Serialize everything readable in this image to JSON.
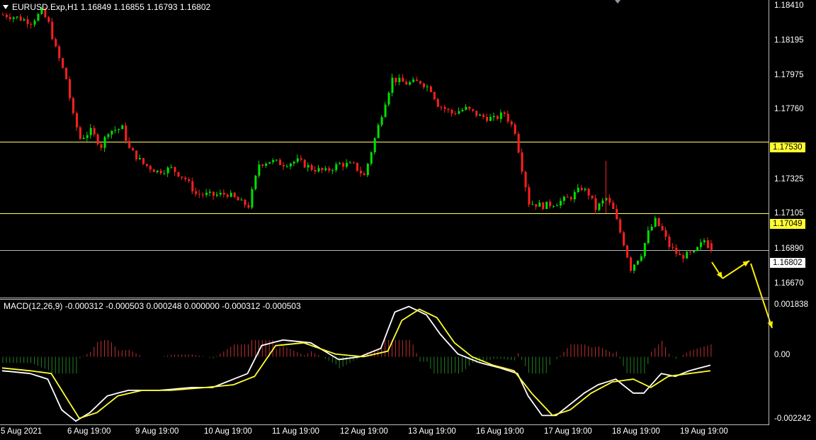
{
  "header": {
    "symbol_line": "EURUSD.Exp,H1  1.16849 1.16855 1.16793 1.16802"
  },
  "macd_header": {
    "label": "MACD(12,26,9) -0.000312 -0.000503 0.000248 0.000000 -0.000312 -0.000503"
  },
  "colors": {
    "background": "#000000",
    "bull_candle": "#00e000",
    "bear_candle": "#ff2020",
    "level_line": "#ffff66",
    "bid_line": "#b0b8c0",
    "macd_main": "#ffffff",
    "macd_signal": "#ffff33",
    "hist_positive": "#c03030",
    "hist_negative": "#208020",
    "arrows": "#ffee00"
  },
  "price_axis": {
    "labels": [
      "1.18410",
      "1.18195",
      "1.17975",
      "1.17760",
      "1.17325",
      "1.17105",
      "1.16890",
      "1.16670"
    ]
  },
  "macd_axis": {
    "labels": [
      "0.001838",
      "0.00",
      "-0.002242"
    ]
  },
  "levels": [
    {
      "price": "1.17530",
      "style": "highlight"
    },
    {
      "price": "1.17049",
      "style": "highlight"
    },
    {
      "price": "1.16802",
      "style": "bid"
    }
  ],
  "time_axis": {
    "labels": [
      "5 Aug 2021",
      "6 Aug 19:00",
      "9 Aug 19:00",
      "10 Aug 19:00",
      "11 Aug 19:00",
      "12 Aug 19:00",
      "13 Aug 19:00",
      "16 Aug 19:00",
      "17 Aug 19:00",
      "18 Aug 19:00",
      "19 Aug 19:00"
    ]
  },
  "chart_data": {
    "type": "candlestick",
    "instrument": "EURUSD.Exp",
    "timeframe": "H1",
    "ohlc_last": {
      "open": 1.16849,
      "high": 1.16855,
      "low": 1.16793,
      "close": 1.16802
    },
    "ylim": [
      1.1658,
      1.1844
    ],
    "price_path": [
      [
        0,
        1.1838
      ],
      [
        4,
        1.1836
      ],
      [
        8,
        1.1833
      ],
      [
        11,
        1.184
      ],
      [
        13,
        1.1832
      ],
      [
        15,
        1.1815
      ],
      [
        18,
        1.1795
      ],
      [
        20,
        1.177
      ],
      [
        22,
        1.1755
      ],
      [
        25,
        1.176
      ],
      [
        28,
        1.175
      ],
      [
        30,
        1.176
      ],
      [
        34,
        1.1762
      ],
      [
        36,
        1.1748
      ],
      [
        40,
        1.1738
      ],
      [
        44,
        1.1733
      ],
      [
        48,
        1.1735
      ],
      [
        52,
        1.1728
      ],
      [
        55,
        1.1718
      ],
      [
        60,
        1.1717
      ],
      [
        64,
        1.1718
      ],
      [
        68,
        1.1712
      ],
      [
        70,
        1.171
      ],
      [
        73,
        1.1738
      ],
      [
        76,
        1.174
      ],
      [
        80,
        1.1738
      ],
      [
        84,
        1.174
      ],
      [
        88,
        1.1735
      ],
      [
        92,
        1.1733
      ],
      [
        96,
        1.1738
      ],
      [
        100,
        1.1737
      ],
      [
        103,
        1.173
      ],
      [
        106,
        1.1755
      ],
      [
        109,
        1.178
      ],
      [
        111,
        1.1795
      ],
      [
        115,
        1.1792
      ],
      [
        119,
        1.1793
      ],
      [
        122,
        1.1788
      ],
      [
        124,
        1.1778
      ],
      [
        128,
        1.1772
      ],
      [
        132,
        1.1775
      ],
      [
        136,
        1.177
      ],
      [
        140,
        1.1768
      ],
      [
        143,
        1.1772
      ],
      [
        146,
        1.176
      ],
      [
        148,
        1.1735
      ],
      [
        150,
        1.1712
      ],
      [
        154,
        1.171
      ],
      [
        158,
        1.1712
      ],
      [
        162,
        1.1716
      ],
      [
        165,
        1.1722
      ],
      [
        167,
        1.1718
      ],
      [
        169,
        1.1708
      ],
      [
        172,
        1.1715
      ],
      [
        174,
        1.1707
      ],
      [
        177,
        1.1685
      ],
      [
        179,
        1.1668
      ],
      [
        182,
        1.1678
      ],
      [
        184,
        1.1692
      ],
      [
        186,
        1.17
      ],
      [
        188,
        1.1693
      ],
      [
        190,
        1.1683
      ],
      [
        193,
        1.1676
      ],
      [
        197,
        1.1678
      ],
      [
        200,
        1.1687
      ],
      [
        202,
        1.168
      ]
    ],
    "macd_ylim": [
      -0.002242,
      0.001838
    ],
    "macd_main_path": [
      [
        0,
        -0.0005
      ],
      [
        8,
        -0.0006
      ],
      [
        13,
        -0.0008
      ],
      [
        17,
        -0.0019
      ],
      [
        21,
        -0.0023
      ],
      [
        25,
        -0.002
      ],
      [
        30,
        -0.0014
      ],
      [
        36,
        -0.0012
      ],
      [
        45,
        -0.0012
      ],
      [
        54,
        -0.0011
      ],
      [
        60,
        -0.0011
      ],
      [
        66,
        -0.0008
      ],
      [
        70,
        -0.0006
      ],
      [
        74,
        0.0004
      ],
      [
        80,
        0.0006
      ],
      [
        88,
        0.0005
      ],
      [
        96,
        -0.0001
      ],
      [
        102,
        0.0
      ],
      [
        108,
        0.0003
      ],
      [
        112,
        0.0016
      ],
      [
        116,
        0.0018
      ],
      [
        121,
        0.0015
      ],
      [
        125,
        0.0008
      ],
      [
        130,
        0.0001
      ],
      [
        136,
        -0.0002
      ],
      [
        142,
        -0.0004
      ],
      [
        147,
        -0.0006
      ],
      [
        150,
        -0.0014
      ],
      [
        154,
        -0.0021
      ],
      [
        158,
        -0.0021
      ],
      [
        162,
        -0.0017
      ],
      [
        166,
        -0.0013
      ],
      [
        170,
        -0.001
      ],
      [
        175,
        -0.0008
      ],
      [
        180,
        -0.0013
      ],
      [
        183,
        -0.0013
      ],
      [
        188,
        -0.0006
      ],
      [
        192,
        -0.0007
      ],
      [
        196,
        -0.0005
      ],
      [
        202,
        -0.0003
      ]
    ],
    "macd_signal_path": [
      [
        0,
        -0.0004
      ],
      [
        8,
        -0.0005
      ],
      [
        14,
        -0.0006
      ],
      [
        18,
        -0.0014
      ],
      [
        22,
        -0.0022
      ],
      [
        27,
        -0.002
      ],
      [
        33,
        -0.0014
      ],
      [
        40,
        -0.0012
      ],
      [
        48,
        -0.0012
      ],
      [
        58,
        -0.0011
      ],
      [
        66,
        -0.001
      ],
      [
        72,
        -0.0007
      ],
      [
        78,
        0.0004
      ],
      [
        86,
        0.0005
      ],
      [
        95,
        0.0001
      ],
      [
        103,
        0.0
      ],
      [
        110,
        0.0002
      ],
      [
        114,
        0.0013
      ],
      [
        119,
        0.0017
      ],
      [
        124,
        0.0014
      ],
      [
        129,
        0.0005
      ],
      [
        134,
        0.0
      ],
      [
        140,
        -0.0003
      ],
      [
        146,
        -0.0005
      ],
      [
        151,
        -0.0013
      ],
      [
        157,
        -0.0021
      ],
      [
        162,
        -0.0019
      ],
      [
        168,
        -0.0013
      ],
      [
        174,
        -0.0009
      ],
      [
        180,
        -0.0008
      ],
      [
        185,
        -0.0011
      ],
      [
        190,
        -0.0007
      ],
      [
        196,
        -0.0006
      ],
      [
        202,
        -0.0005
      ]
    ],
    "projection_arrows": [
      {
        "from": [
          1005,
          370
        ],
        "to": [
          1020,
          393
        ]
      },
      {
        "from": [
          1020,
          393
        ],
        "to": [
          1058,
          368
        ]
      },
      {
        "from": [
          1060,
          372
        ],
        "to": [
          1090,
          463
        ]
      }
    ]
  }
}
